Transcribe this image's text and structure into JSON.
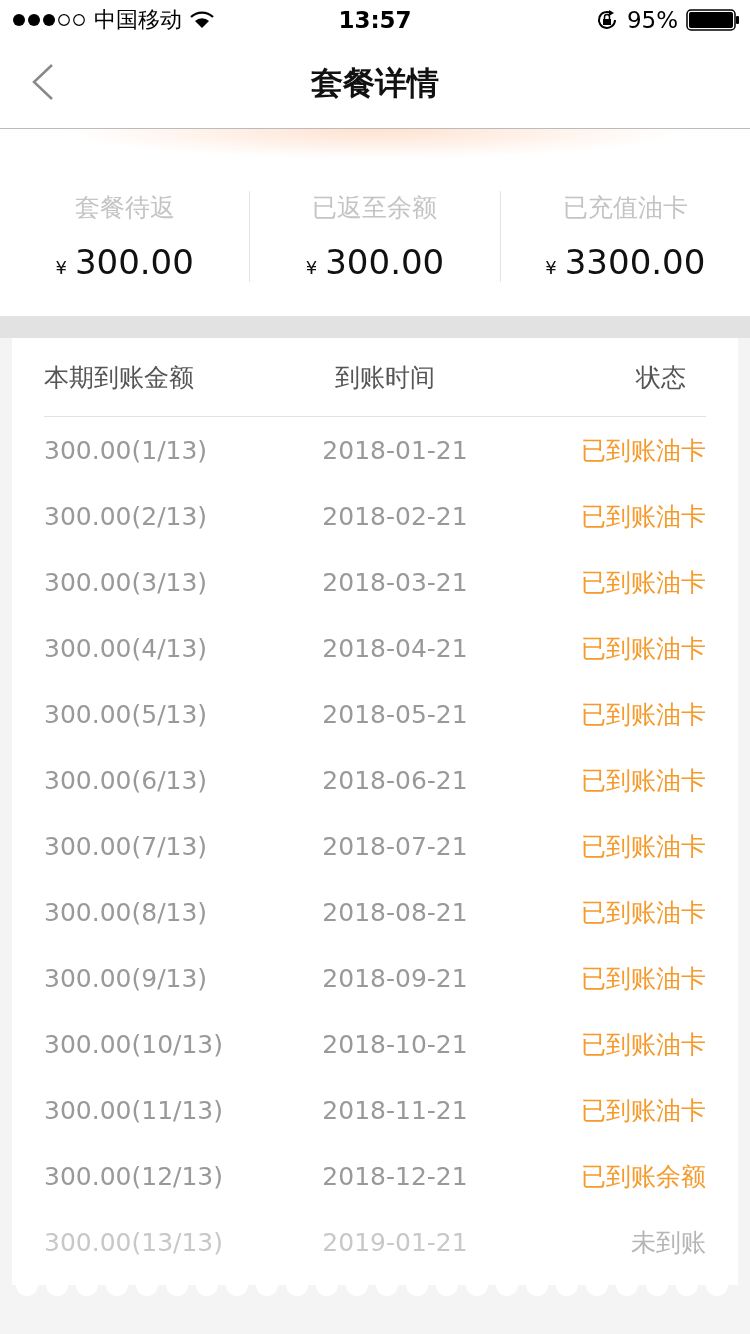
{
  "status_bar": {
    "carrier": "中国移动",
    "time": "13:57",
    "battery": "95%"
  },
  "nav": {
    "title": "套餐详情"
  },
  "summary": [
    {
      "label": "套餐待返",
      "currency": "¥",
      "amount": "300.00"
    },
    {
      "label": "已返至余额",
      "currency": "¥",
      "amount": "300.00"
    },
    {
      "label": "已充值油卡",
      "currency": "¥",
      "amount": "3300.00"
    }
  ],
  "table": {
    "columns": [
      "本期到账金额",
      "到账时间",
      "状态"
    ],
    "rows": [
      {
        "amount": "300.00(1/13)",
        "date": "2018-01-21",
        "status": "已到账油卡",
        "arrived": true
      },
      {
        "amount": "300.00(2/13)",
        "date": "2018-02-21",
        "status": "已到账油卡",
        "arrived": true
      },
      {
        "amount": "300.00(3/13)",
        "date": "2018-03-21",
        "status": "已到账油卡",
        "arrived": true
      },
      {
        "amount": "300.00(4/13)",
        "date": "2018-04-21",
        "status": "已到账油卡",
        "arrived": true
      },
      {
        "amount": "300.00(5/13)",
        "date": "2018-05-21",
        "status": "已到账油卡",
        "arrived": true
      },
      {
        "amount": "300.00(6/13)",
        "date": "2018-06-21",
        "status": "已到账油卡",
        "arrived": true
      },
      {
        "amount": "300.00(7/13)",
        "date": "2018-07-21",
        "status": "已到账油卡",
        "arrived": true
      },
      {
        "amount": "300.00(8/13)",
        "date": "2018-08-21",
        "status": "已到账油卡",
        "arrived": true
      },
      {
        "amount": "300.00(9/13)",
        "date": "2018-09-21",
        "status": "已到账油卡",
        "arrived": true
      },
      {
        "amount": "300.00(10/13)",
        "date": "2018-10-21",
        "status": "已到账油卡",
        "arrived": true
      },
      {
        "amount": "300.00(11/13)",
        "date": "2018-11-21",
        "status": "已到账油卡",
        "arrived": true
      },
      {
        "amount": "300.00(12/13)",
        "date": "2018-12-21",
        "status": "已到账余额",
        "arrived": true
      },
      {
        "amount": "300.00(13/13)",
        "date": "2019-01-21",
        "status": "未到账",
        "arrived": false
      }
    ]
  }
}
